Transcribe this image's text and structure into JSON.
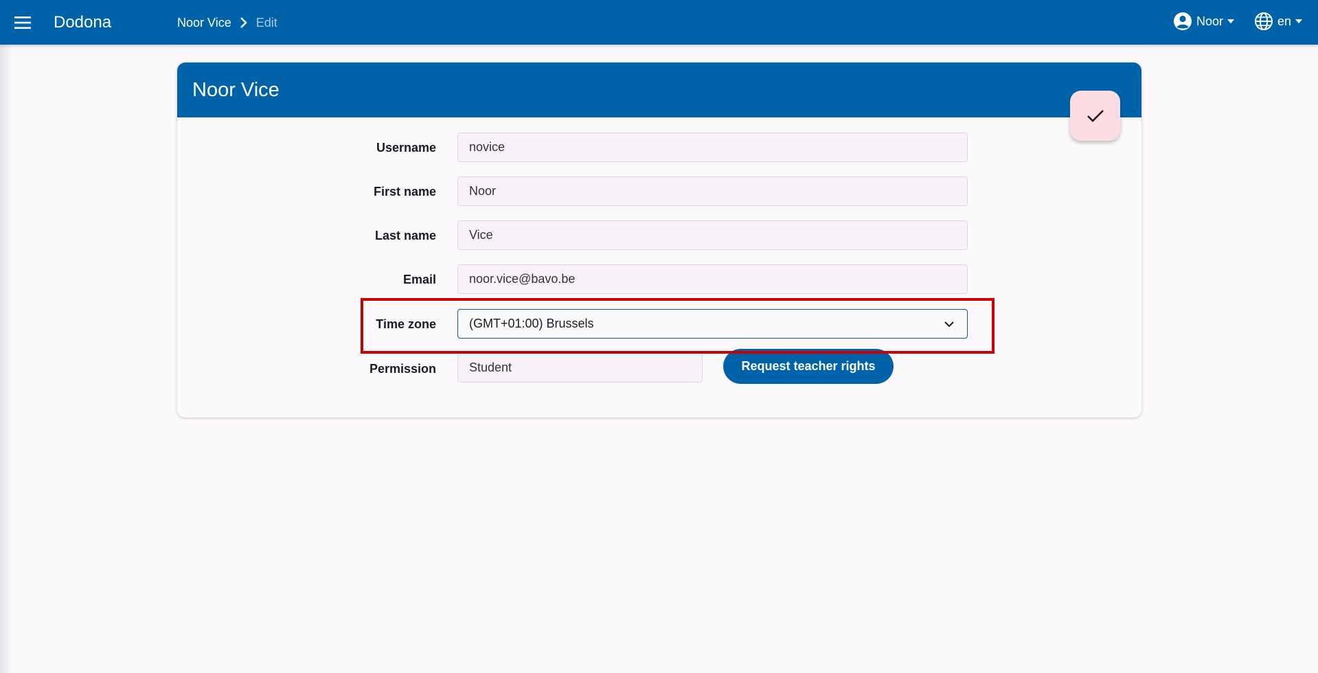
{
  "app": {
    "brand": "Dodona"
  },
  "breadcrumb": {
    "parent": "Noor Vice",
    "current": "Edit"
  },
  "user_menu": {
    "label": "Noor"
  },
  "lang_menu": {
    "label": "en"
  },
  "card": {
    "title": "Noor Vice"
  },
  "form": {
    "username": {
      "label": "Username",
      "value": "novice"
    },
    "first_name": {
      "label": "First name",
      "value": "Noor"
    },
    "last_name": {
      "label": "Last name",
      "value": "Vice"
    },
    "email": {
      "label": "Email",
      "value": "noor.vice@bavo.be"
    },
    "time_zone": {
      "label": "Time zone",
      "value": "(GMT+01:00) Brussels"
    },
    "permission": {
      "label": "Permission",
      "value": "Student",
      "request_button": "Request teacher rights"
    }
  },
  "colors": {
    "primary": "#0063aa",
    "fab": "#fcdde4",
    "highlight": "#cc0000",
    "background": "#fcf9fd"
  },
  "icons": {
    "menu": "menu-icon",
    "breadcrumb_sep": "chevron-right-icon",
    "account": "account-circle-icon",
    "language": "globe-icon",
    "save": "check-icon",
    "select": "chevron-down-icon"
  }
}
